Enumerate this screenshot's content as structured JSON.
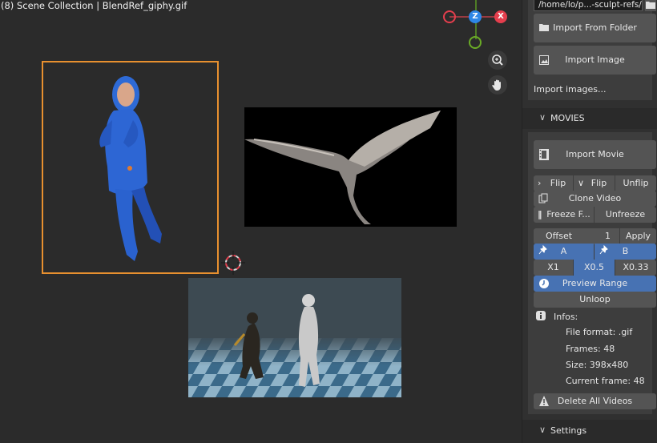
{
  "viewport": {
    "title": "(8) Scene Collection | BlendRef_giphy.gif",
    "gizmo": {
      "z": "Z",
      "x": "X"
    }
  },
  "sidebar": {
    "path": "/home/lo/p...-sculpt-refs/",
    "import_folder": "Import From Folder",
    "import_image": "Import Image",
    "import_images_label": "Import images...",
    "movies_header": "MOVIES",
    "import_movie": "Import Movie",
    "flip_1": "Flip",
    "flip_2": "Flip",
    "unflip": "Unflip",
    "clone_video": "Clone Video",
    "freeze": "Freeze F...",
    "unfreeze": "Unfreeze",
    "offset_label": "Offset",
    "offset_value": "1",
    "apply": "Apply",
    "marker_a": "A",
    "marker_b": "B",
    "speed_x1": "X1",
    "speed_x05": "X0.5",
    "speed_x033": "X0.33",
    "preview_range": "Preview Range",
    "unloop": "Unloop",
    "infos_label": "Infos:",
    "file_format": "File format: .gif",
    "frames": "Frames: 48",
    "size": "Size: 398x480",
    "current_frame": "Current frame: 48",
    "delete_all": "Delete All Videos",
    "settings_header": "Settings"
  },
  "colors": {
    "viewport_bg": "#2b2b2b",
    "sidebar_bg": "#303030",
    "button": "#545454",
    "active_blue": "#4772b3",
    "selection_orange": "#e8902f",
    "axis_x": "#e53e4d",
    "axis_y": "#6aab26",
    "axis_z": "#2e87e6"
  },
  "icons": [
    "folder-icon",
    "image-icon",
    "film-icon",
    "chevron-right-icon",
    "chevron-down-icon",
    "duplicate-icon",
    "pause-icon",
    "pin-icon",
    "clock-icon",
    "info-icon",
    "warning-icon",
    "zoom-icon",
    "hand-icon",
    "3d-cursor-icon"
  ]
}
